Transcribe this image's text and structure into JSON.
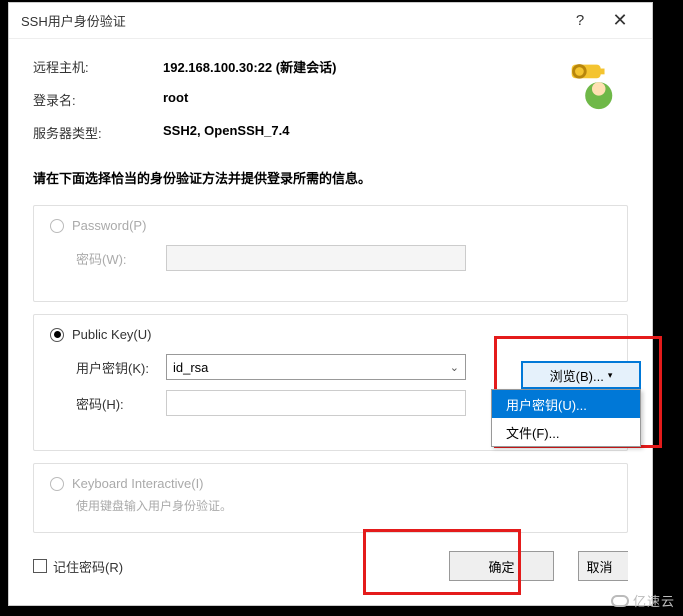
{
  "window": {
    "title": "SSH用户身份验证"
  },
  "info": {
    "remote_host_label": "远程主机:",
    "remote_host_value": "192.168.100.30:22 (新建会话)",
    "login_label": "登录名:",
    "login_value": "root",
    "server_type_label": "服务器类型:",
    "server_type_value": "SSH2, OpenSSH_7.4"
  },
  "instruction": "请在下面选择恰当的身份验证方法并提供登录所需的信息。",
  "password_section": {
    "radio_label": "Password(P)",
    "field_label": "密码(W):",
    "value": ""
  },
  "publickey_section": {
    "radio_label": "Public Key(U)",
    "key_label": "用户密钥(K):",
    "key_value": "id_rsa",
    "pass_label": "密码(H):",
    "pass_value": "",
    "browse_label": "浏览(B)...",
    "menu": {
      "user_key": "用户密钥(U)...",
      "file": "文件(F)..."
    }
  },
  "keyboard_section": {
    "radio_label": "Keyboard Interactive(I)",
    "desc": "使用键盘输入用户身份验证。"
  },
  "bottom": {
    "remember_label": "记住密码(R)",
    "ok": "确定",
    "cancel": "取消"
  },
  "watermark": "亿速云"
}
